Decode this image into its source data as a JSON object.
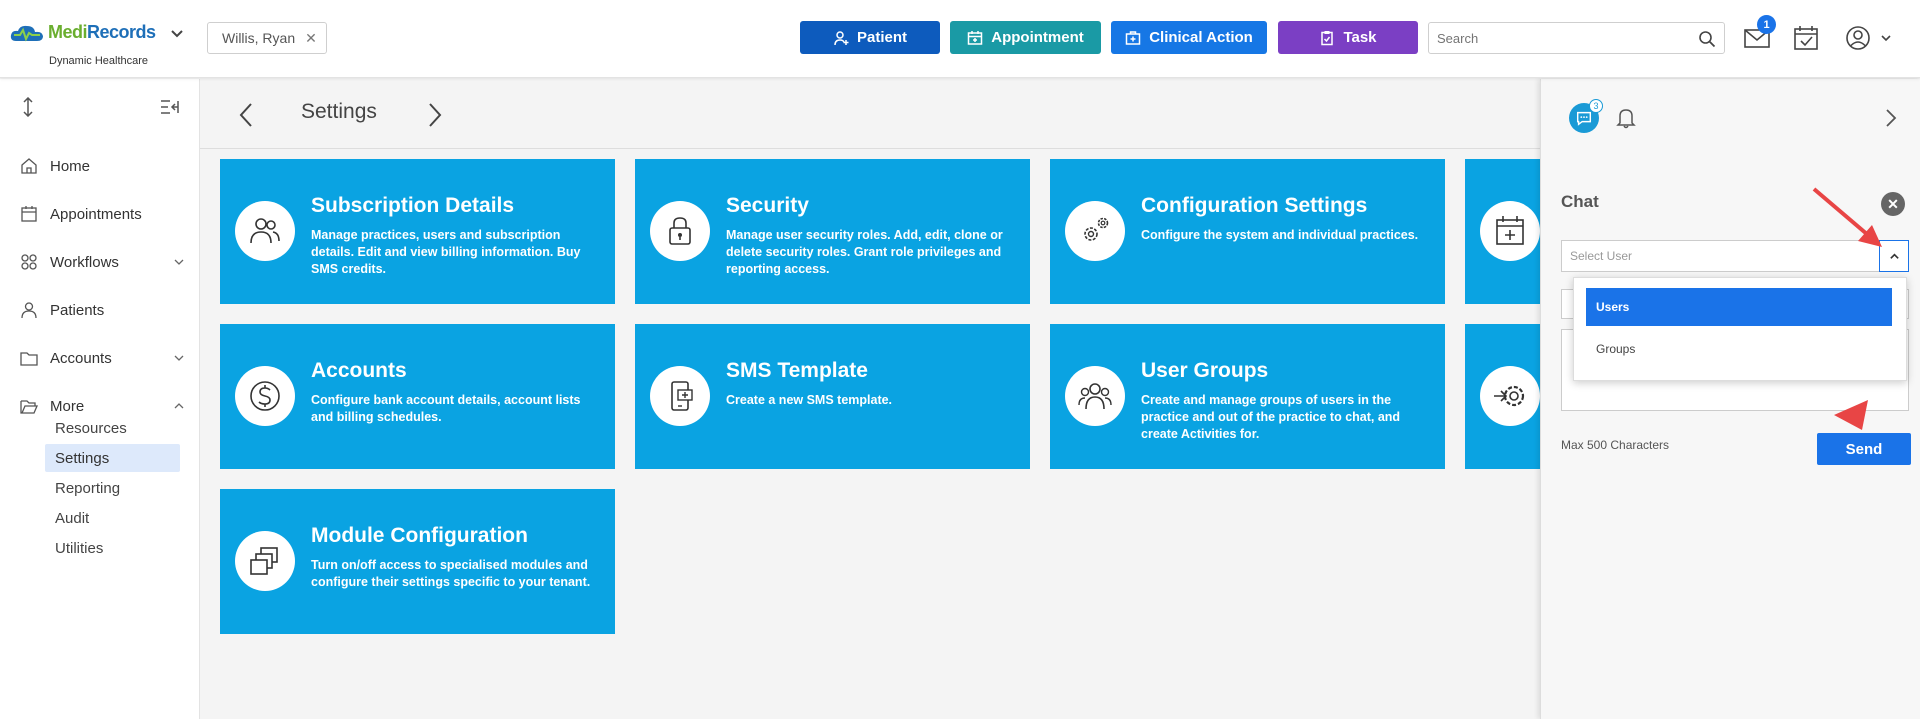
{
  "brand": {
    "name_part1": "Medi",
    "name_part2": "Records",
    "subtitle": "Dynamic Healthcare"
  },
  "header": {
    "patient_chip": "Willis, Ryan",
    "buttons": [
      {
        "label": "Patient",
        "color": "#0d5bbd"
      },
      {
        "label": "Appointment",
        "color": "#1a9aa5"
      },
      {
        "label": "Clinical Action",
        "color": "#1677e5"
      },
      {
        "label": "Task",
        "color": "#7b3fc4"
      }
    ],
    "search_placeholder": "Search",
    "mail_badge": "1"
  },
  "sidebar": {
    "items": [
      {
        "label": "Home",
        "icon": "home-icon"
      },
      {
        "label": "Appointments",
        "icon": "calendar-icon"
      },
      {
        "label": "Workflows",
        "icon": "workflow-icon"
      },
      {
        "label": "Patients",
        "icon": "patients-icon"
      },
      {
        "label": "Accounts",
        "icon": "folder-icon"
      },
      {
        "label": "More",
        "icon": "folder-open-icon"
      }
    ],
    "sub_items": [
      "Resources",
      "Settings",
      "Reporting",
      "Audit",
      "Utilities"
    ],
    "active_sub": "Settings"
  },
  "page": {
    "title": "Settings"
  },
  "tiles": [
    {
      "title": "Subscription Details",
      "desc": "Manage practices, users and subscription details. Edit and view billing information. Buy SMS credits.",
      "icon": "users-icon"
    },
    {
      "title": "Security",
      "desc": "Manage user security roles. Add, edit, clone or delete security roles. Grant role privileges and reporting access.",
      "icon": "lock-icon"
    },
    {
      "title": "Configuration Settings",
      "desc": "Configure the system and individual practices.",
      "icon": "gears-icon"
    },
    {
      "title": "Accounts",
      "desc": "Configure bank account details, account lists and billing schedules.",
      "icon": "dollar-icon"
    },
    {
      "title": "SMS Template",
      "desc": "Create a new SMS template.",
      "icon": "phone-icon"
    },
    {
      "title": "User Groups",
      "desc": "Create and manage groups of users in the practice and out of the practice to chat, and create Activities for.",
      "icon": "user-group-icon"
    },
    {
      "title": "Module Configuration",
      "desc": "Turn on/off access to specialised modules and configure their settings specific to your tenant.",
      "icon": "modules-icon"
    }
  ],
  "chat": {
    "title": "Chat",
    "chat_count": "3",
    "select_placeholder": "Select User",
    "dropdown_options": [
      "Users",
      "Groups"
    ],
    "selected_option": "Users",
    "max_chars": "Max 500 Characters",
    "send_label": "Send"
  },
  "colors": {
    "tile": "#0aa3e2",
    "accent": "#1a73e8",
    "annotation_arrow": "#e84545"
  }
}
